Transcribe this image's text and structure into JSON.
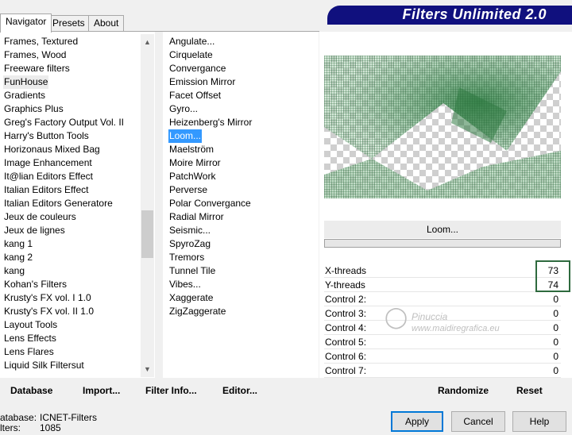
{
  "tabs": [
    "Navigator",
    "Presets",
    "About"
  ],
  "banner_title": "Filters Unlimited 2.0",
  "categories": {
    "items": [
      "Frames, Textured",
      "Frames, Wood",
      "Freeware filters",
      "FunHouse",
      "Gradients",
      "Graphics Plus",
      "Greg's Factory Output Vol. II",
      "Harry's Button Tools",
      "Horizonaus Mixed Bag",
      "Image Enhancement",
      "It@lian Editors Effect",
      "Italian Editors Effect",
      "Italian Editors Generatore",
      "Jeux de couleurs",
      "Jeux de lignes",
      "kang 1",
      "kang 2",
      "kang",
      "Kohan's Filters",
      "Krusty's FX vol. I 1.0",
      "Krusty's FX vol. II 1.0",
      "Layout Tools",
      "Lens Effects",
      "Lens Flares",
      "Liquid Silk Filtersut"
    ],
    "selected_index": 3
  },
  "filters": {
    "items": [
      "Angulate...",
      "Cirquelate",
      "Convergance",
      "Emission Mirror",
      "Facet Offset",
      "Gyro...",
      "Heizenberg's Mirror",
      "Loom...",
      "Maelström",
      "Moire Mirror",
      "PatchWork",
      "Perverse",
      "Polar Convergance",
      "Radial Mirror",
      "Seismic...",
      "SpyroZag",
      "Tremors",
      "Tunnel Tile",
      "Vibes...",
      "Xaggerate",
      "ZigZaggerate"
    ],
    "selected_index": 7
  },
  "current_filter": "Loom...",
  "controls": [
    {
      "label": "X-threads",
      "value": "73"
    },
    {
      "label": "Y-threads",
      "value": "74"
    },
    {
      "label": "Control 2:",
      "value": "0"
    },
    {
      "label": "Control 3:",
      "value": "0"
    },
    {
      "label": "Control 4:",
      "value": "0"
    },
    {
      "label": "Control 5:",
      "value": "0"
    },
    {
      "label": "Control 6:",
      "value": "0"
    },
    {
      "label": "Control 7:",
      "value": "0"
    }
  ],
  "watermark": {
    "line1": "Pinuccia",
    "line2": "www.maidiregrafica.eu"
  },
  "toolbar": {
    "database": "Database",
    "import": "Import...",
    "filter_info": "Filter Info...",
    "editor": "Editor...",
    "randomize": "Randomize",
    "reset": "Reset"
  },
  "status": {
    "database_label": "atabase:",
    "database_value": "ICNET-Filters",
    "filters_label": "lters:",
    "filters_value": "1085"
  },
  "buttons": {
    "apply": "Apply",
    "cancel": "Cancel",
    "help": "Help"
  },
  "colors": {
    "banner": "#10107e",
    "selection": "#3399ff",
    "highlight_box": "#2e6a3e",
    "preview_green": "#2f7a42"
  }
}
